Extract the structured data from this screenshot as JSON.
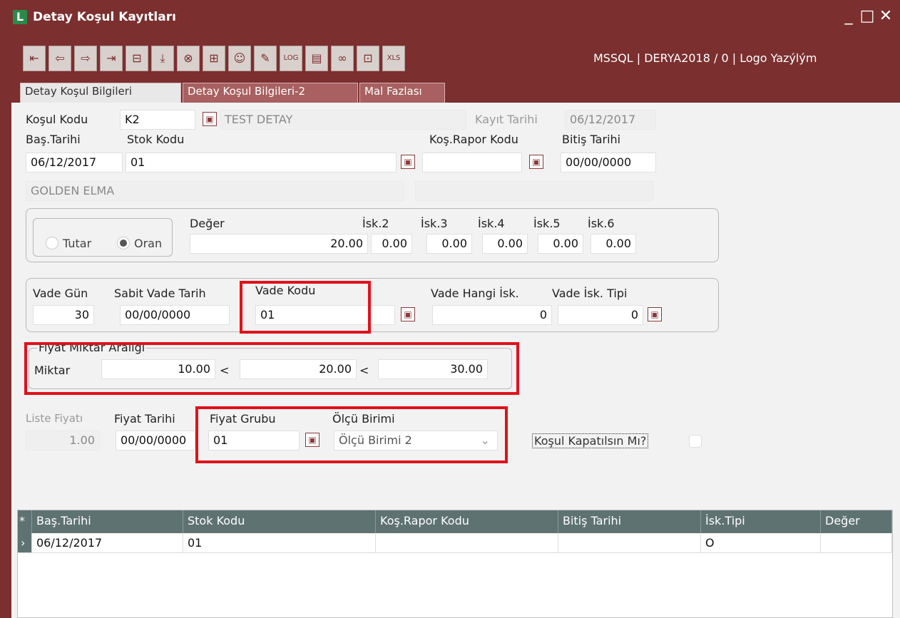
{
  "window": {
    "title": "Detay Koşul Kayıtları",
    "logo_letter": "L"
  },
  "toolbar": {
    "db_info": "MSSQL | DERYA2018 / 0 | Logo Yazýlým",
    "buttons": [
      "first-icon",
      "prev-icon",
      "next-icon",
      "last-icon",
      "minus-doc-icon",
      "download-icon",
      "cancel-icon",
      "add-doc-icon",
      "user-icon",
      "pencil-icon",
      "log-icon",
      "note-icon",
      "link-icon",
      "lock-icon",
      "xls-icon"
    ],
    "log_label": "LOG",
    "xls_label": "XLS"
  },
  "tabs": [
    "Detay Koşul Bilgileri",
    "Detay Koşul Bilgileri-2",
    "Mal Fazlası"
  ],
  "form": {
    "kosul_kodu_label": "Koşul Kodu",
    "kosul_kodu": "K2",
    "kosul_aciklama": "TEST DETAY",
    "kayit_tarihi_label": "Kayıt Tarihi",
    "kayit_tarihi": "06/12/2017",
    "bas_tarihi_label": "Baş.Tarihi",
    "bas_tarihi": "06/12/2017",
    "stok_kodu_label": "Stok Kodu",
    "stok_kodu": "01",
    "kos_rapor_kodu_label": "Koş.Rapor Kodu",
    "kos_rapor_kodu": "",
    "bitis_tarihi_label": "Bitiş Tarihi",
    "bitis_tarihi": "00/00/0000",
    "stok_aciklama": "GOLDEN ELMA",
    "stok_aciklama2": ""
  },
  "discount": {
    "tutar_label": "Tutar",
    "oran_label": "Oran",
    "selected": "Oran",
    "deger_label": "Değer",
    "deger": "20.00",
    "isk2_label": "İsk.2",
    "isk2": "0.00",
    "isk3_label": "İsk.3",
    "isk3": "0.00",
    "isk4_label": "İsk.4",
    "isk4": "0.00",
    "isk5_label": "İsk.5",
    "isk5": "0.00",
    "isk6_label": "İsk.6",
    "isk6": "0.00"
  },
  "vade": {
    "gun_label": "Vade Gün",
    "gun": "30",
    "sabit_label": "Sabit Vade Tarih",
    "sabit": "00/00/0000",
    "kodu_label": "Vade Kodu",
    "kodu": "01",
    "hangi_isk_label": "Vade Hangi İsk.",
    "hangi_isk": "0",
    "isk_tipi_label": "Vade İsk. Tipi",
    "isk_tipi": "0"
  },
  "fiyat_miktar": {
    "legend": "Fiyat Miktar Aralığı",
    "miktar_label": "Miktar",
    "min": "10.00",
    "mid": "20.00",
    "max": "30.00",
    "lt": "<"
  },
  "price": {
    "liste_fiyati_label": "Liste Fiyatı",
    "liste_fiyati": "1.00",
    "fiyat_tarihi_label": "Fiyat Tarihi",
    "fiyat_tarihi": "00/00/0000",
    "fiyat_grubu_label": "Fiyat Grubu",
    "fiyat_grubu": "01",
    "olcu_birimi_label": "Ölçü Birimi",
    "olcu_birimi": "Ölçü Birimi 2",
    "kapatilsin_label": "Koşul Kapatılsın Mı?"
  },
  "grid": {
    "columns": [
      "Baş.Tarihi",
      "Stok Kodu",
      "Koş.Rapor Kodu",
      "Bitiş Tarihi",
      "İsk.Tipi",
      "Değer"
    ],
    "rows": [
      [
        "06/12/2017",
        "01",
        "",
        "",
        "O",
        ""
      ]
    ]
  }
}
